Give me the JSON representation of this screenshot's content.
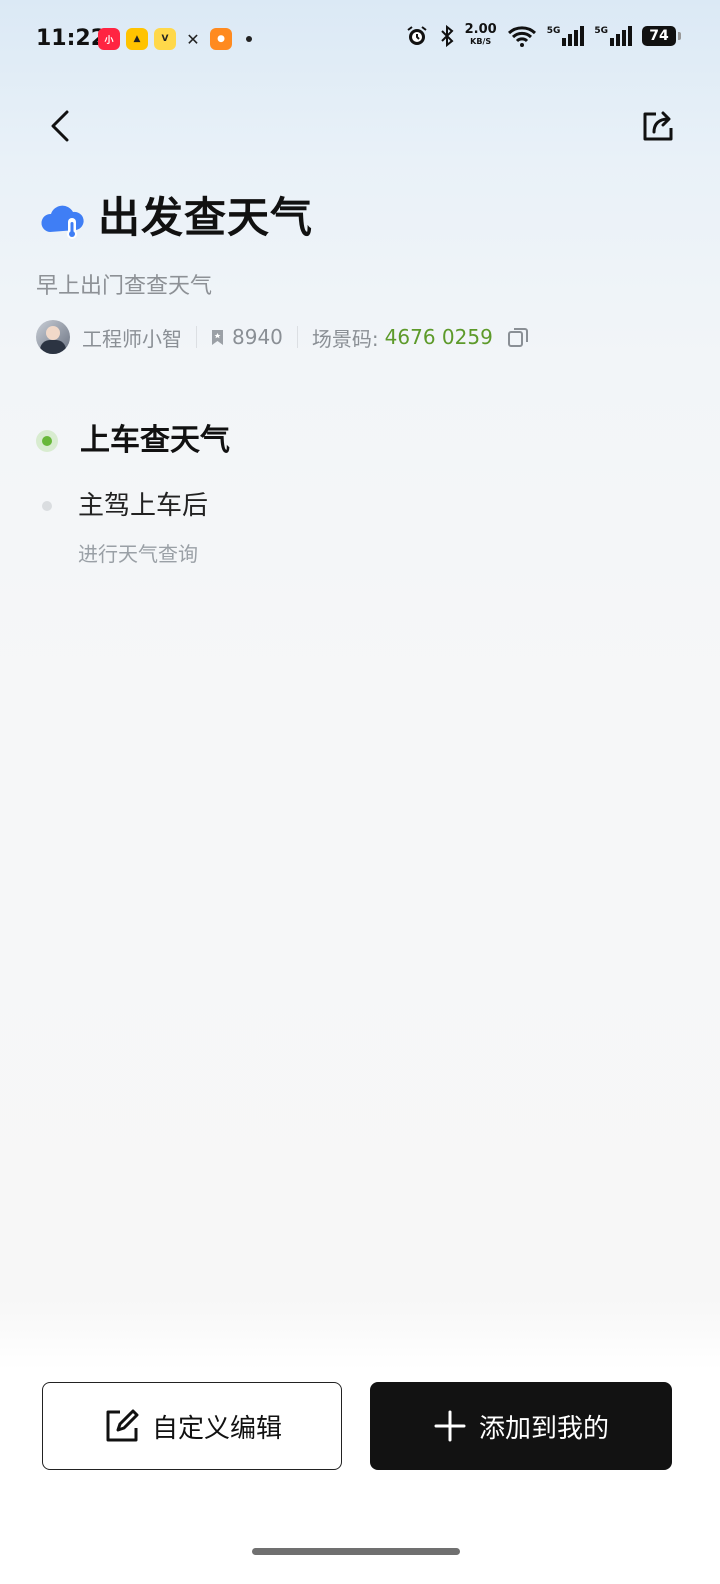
{
  "status_bar": {
    "time": "11:22",
    "net_speed": "2.00",
    "net_unit": "KB/S",
    "signal1": "5G",
    "signal2": "5G",
    "battery": "74"
  },
  "header": {
    "back_icon": "chevron-left-icon",
    "share_icon": "share-icon"
  },
  "scene": {
    "title": "出发查天气",
    "subtitle": "早上出门查查天气",
    "author": "工程师小智",
    "favorites": "8940",
    "code_label": "场景码:",
    "code_value": "4676 0259",
    "accent_color": "#5d9a2a"
  },
  "steps": {
    "trigger_title": "上车查天气",
    "condition": "主驾上车后",
    "action": "进行天气查询"
  },
  "actions": {
    "edit_label": "自定义编辑",
    "add_label": "添加到我的"
  }
}
